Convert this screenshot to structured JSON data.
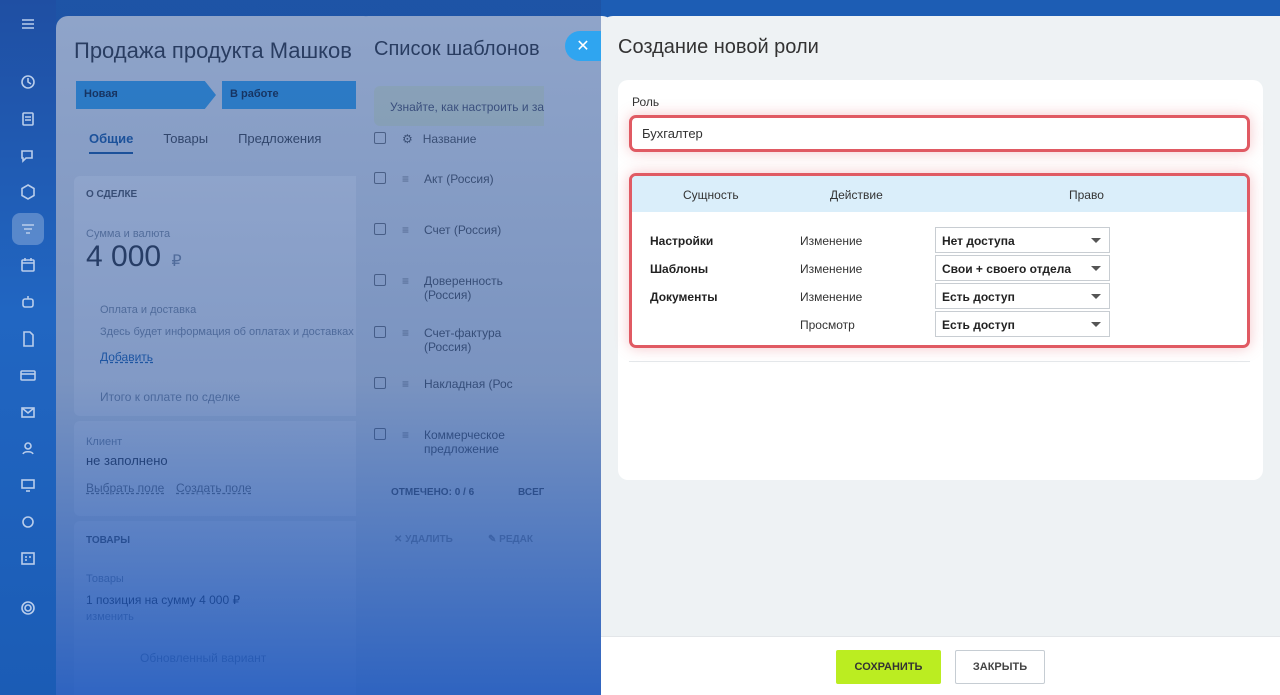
{
  "deal_card": {
    "title": "Продажа продукта Машков",
    "stages": [
      "Новая",
      "В работе"
    ],
    "tabs": [
      "Общие",
      "Товары",
      "Предложения"
    ],
    "about_header": "О СДЕЛКЕ",
    "sum_label": "Сумма и валюта",
    "sum_value": "4 000",
    "currency": "₽",
    "payment_title": "Оплата и доставка",
    "payment_text": "Здесь будет информация об оплатах и доставках",
    "add_link": "Добавить",
    "total_label": "Итого к оплате по сделке",
    "client_label": "Клиент",
    "client_value": "не заполнено",
    "select_field": "Выбрать поле",
    "create_field": "Создать поле",
    "goods_header": "ТОВАРЫ",
    "goods_label": "Товары",
    "goods_value": "1 позиция на сумму 4 000 ₽",
    "goods_edit": "изменить",
    "goods_hint": "Обновленный вариант"
  },
  "templates_card": {
    "title": "Список шаблонов",
    "hint": "Узнайте, как настроить и за",
    "column_name": "Название",
    "rows": [
      "Акт (Россия)",
      "Счет (Россия)",
      "Доверенность (Россия)",
      "Счет-фактура (Россия)",
      "Накладная (Рос",
      "Коммерческое предложение"
    ],
    "selected": "ОТМЕЧЕНО: 0 / 6",
    "all_label": "ВСЕГ",
    "delete_label": "УДАЛИТЬ",
    "edit_label": "РЕДАК"
  },
  "panel": {
    "title": "Создание новой роли",
    "role_label": "Роль",
    "role_value": "Бухгалтер",
    "headers": {
      "entity": "Сущность",
      "action": "Действие",
      "right": "Право"
    },
    "rows": [
      {
        "entity": "Настройки",
        "action": "Изменение",
        "right": "Нет доступа"
      },
      {
        "entity": "Шаблоны",
        "action": "Изменение",
        "right": "Свои + своего отдела"
      },
      {
        "entity": "Документы",
        "action": "Изменение",
        "right": "Есть доступ"
      },
      {
        "entity": "",
        "action": "Просмотр",
        "right": "Есть доступ"
      }
    ],
    "save": "СОХРАНИТЬ",
    "close": "ЗАКРЫТЬ"
  },
  "colors": {
    "accent": "#bbed21",
    "highlight": "#e05a63",
    "rail": "#1f4fa3",
    "header_bg": "#daeefa"
  },
  "icons": [
    "menu-icon",
    "activity-icon",
    "tasks-icon",
    "chat-icon",
    "hexagon-icon",
    "crm-icon",
    "calendar-icon",
    "robot-icon",
    "document-icon",
    "card-icon",
    "mail-icon",
    "contacts-icon",
    "monitor-icon",
    "badge-icon",
    "schedule-icon",
    "settings-icon",
    "close-icon"
  ]
}
